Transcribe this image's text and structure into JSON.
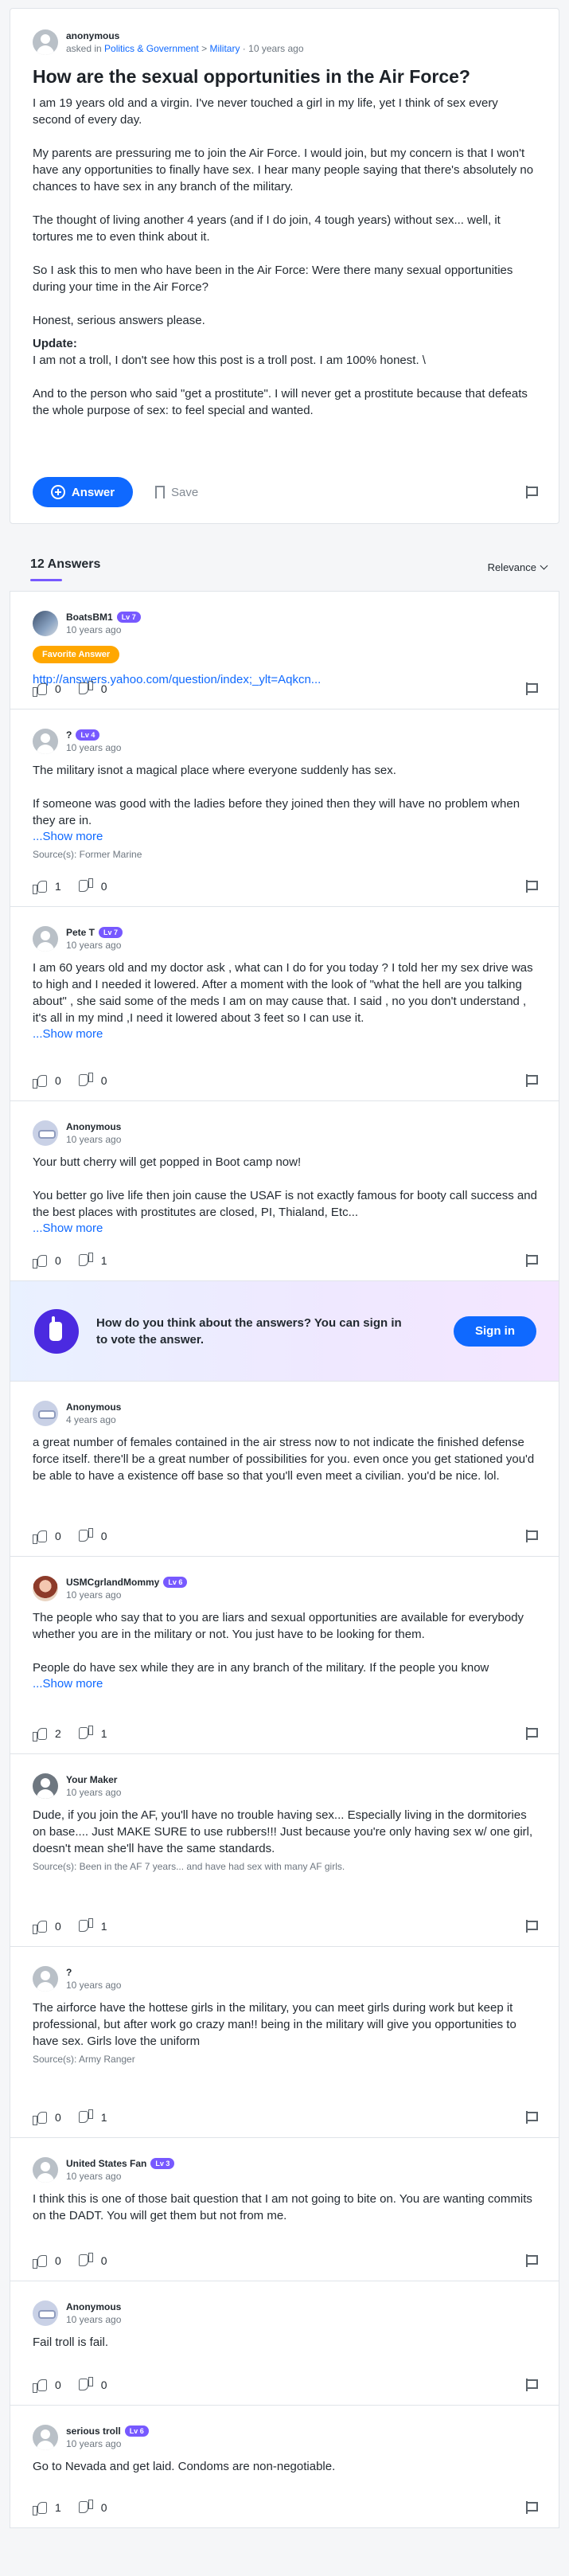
{
  "question": {
    "author": "anonymous",
    "asked_in_prefix": "asked in",
    "category": "Politics & Government",
    "subcategory": "Military",
    "time": "10 years ago",
    "title": "How are the sexual opportunities in the Air Force?",
    "paragraphs": [
      "I am 19 years old and a virgin. I've never touched a girl in my life, yet I think of sex every second of every day.",
      "My parents are pressuring me to join the Air Force. I would join, but my concern is that I won't have any opportunities to finally have sex. I hear many people saying that there's absolutely no chances to have sex in any branch of the military.",
      "The thought of living another 4 years (and if I do join, 4 tough years) without sex... well, it tortures me to even think about it.",
      "So I ask this to men who have been in the Air Force: Were there many sexual opportunities during your time in the Air Force?",
      "Honest, serious answers please."
    ],
    "update_label": "Update:",
    "update_paragraphs": [
      "I am not a troll, I don't see how this post is a troll post. I am 100% honest. \\",
      "And to the person who said \"get a prostitute\". I will never get a prostitute because that defeats the whole purpose of sex: to feel special and wanted."
    ],
    "answer_label": "Answer",
    "save_label": "Save"
  },
  "answers_header": {
    "count_label": "12 Answers",
    "sort_label": "Relevance"
  },
  "answers": [
    {
      "name": "BoatsBM1",
      "level": "Lv 7",
      "time": "10 years ago",
      "badge": "Favorite Answer",
      "link": "http://answers.yahoo.com/question/index;_ylt=Aqkcn...",
      "up": "0",
      "down": "0"
    },
    {
      "name": "?",
      "level": "Lv 4",
      "time": "10 years ago",
      "paragraphs": [
        "The military isnot a magical place where everyone suddenly has sex.",
        "If someone was good with the ladies before they joined then they will have no problem when they are in."
      ],
      "show_more": "...Show more",
      "source": "Source(s): Former Marine",
      "up": "1",
      "down": "0"
    },
    {
      "name": "Pete T",
      "level": "Lv 7",
      "time": "10 years ago",
      "paragraphs": [
        "I am 60 years old and my doctor ask , what can I do for you today ? I told her my sex drive was to high and I needed it lowered. After a moment with the look of \"what the hell are you talking about\" , she said some of the meds I am on may cause that. I said , no you don't understand , it's all in my mind ,I need it lowered about 3 feet so I can use it."
      ],
      "show_more": "...Show more",
      "up": "0",
      "down": "0"
    },
    {
      "name": "Anonymous",
      "time": "10 years ago",
      "paragraphs": [
        "Your butt cherry will get popped in Boot camp now!",
        "You better go live life then join cause the USAF is not exactly famous for booty call success and the best places with prostitutes are closed, PI, Thialand, Etc..."
      ],
      "show_more": "...Show more",
      "up": "0",
      "down": "1"
    },
    {
      "name": "Anonymous",
      "time": "4 years ago",
      "paragraphs": [
        "a great number of females contained in the air stress now to not indicate the finished defense force itself. there'll be a great number of possibilities for you. even once you get stationed you'd be able to have a existence off base so that you'll even meet a civilian. you'd be nice. lol."
      ],
      "up": "0",
      "down": "0"
    },
    {
      "name": "USMCgrlandMommy",
      "level": "Lv 6",
      "time": "10 years ago",
      "paragraphs": [
        "The people who say that to you are liars and sexual opportunities are available for everybody whether you are in the military or not. You just have to be looking for them.",
        "People do have sex while they are in any branch of the military. If the people you know"
      ],
      "show_more": "...Show more",
      "up": "2",
      "down": "1"
    },
    {
      "name": "Your Maker",
      "time": "10 years ago",
      "paragraphs": [
        "Dude, if you join the AF, you'll have no trouble having sex... Especially living in the dormitories on base.... Just MAKE SURE to use rubbers!!! Just because you're only having sex w/ one girl, doesn't mean she'll have the same standards."
      ],
      "source": "Source(s): Been in the AF 7 years... and have had sex with many AF girls.",
      "up": "0",
      "down": "1"
    },
    {
      "name": "?",
      "time": "10 years ago",
      "paragraphs": [
        "The airforce have the hottese girls in the military, you can meet girls during work but keep it professional, but after work go crazy man!! being in the military will give you opportunities to have sex. Girls love the uniform"
      ],
      "source": "Source(s): Army Ranger",
      "up": "0",
      "down": "1"
    },
    {
      "name": "United States Fan",
      "level": "Lv 3",
      "time": "10 years ago",
      "paragraphs": [
        "I think this is one of those bait question that I am not going to bite on.  You are wanting commits on the DADT.  You will get them but not from me."
      ],
      "up": "0",
      "down": "0"
    },
    {
      "name": "Anonymous",
      "time": "10 years ago",
      "paragraphs": [
        "Fail troll is fail."
      ],
      "up": "0",
      "down": "0"
    },
    {
      "name": "serious troll",
      "level": "Lv 6",
      "time": "10 years ago",
      "paragraphs": [
        "Go to Nevada and get laid. Condoms are non-negotiable."
      ],
      "up": "1",
      "down": "0"
    }
  ],
  "signin_banner": {
    "text": "How do you think about the answers? You can sign in to vote the answer.",
    "button_label": "Sign in"
  }
}
